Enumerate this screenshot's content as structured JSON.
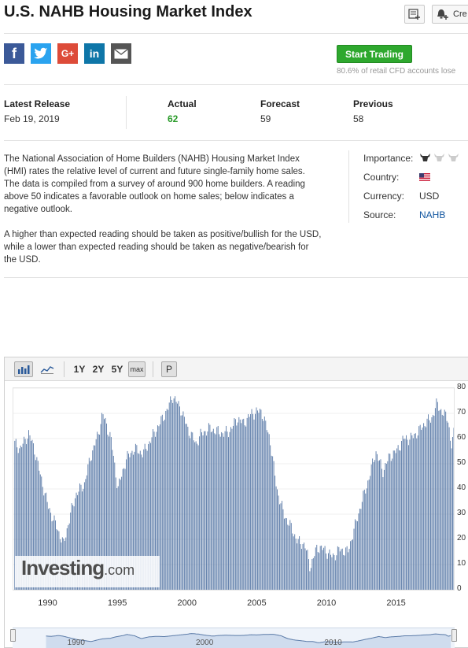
{
  "page": {
    "title": "U.S. NAHB Housing Market Index",
    "alert_label": "Cre"
  },
  "share": {
    "facebook": "f",
    "twitter": "t",
    "googleplus": "G+",
    "linkedin": "in",
    "email": "✉"
  },
  "cta": {
    "start_trading": "Start Trading",
    "risk_note": "80.6% of retail CFD accounts lose"
  },
  "release": {
    "latest_label": "Latest Release",
    "latest_date": "Feb 19, 2019",
    "actual_label": "Actual",
    "actual_value": "62",
    "forecast_label": "Forecast",
    "forecast_value": "59",
    "previous_label": "Previous",
    "previous_value": "58"
  },
  "description": {
    "p1": "The National Association of Home Builders (NAHB) Housing Market Index (HMI) rates the relative level of current and future single-family home sales. The data is compiled from a survey of around 900 home builders. A reading above 50 indicates a favorable outlook on home sales; below indicates a negative outlook.",
    "p2": "A higher than expected reading should be taken as positive/bullish for the USD, while a lower than expected reading should be taken as negative/bearish for the USD."
  },
  "info": {
    "importance_label": "Importance:",
    "importance_level": 1,
    "importance_max": 3,
    "country_label": "Country:",
    "country_flag": "us-flag-icon",
    "currency_label": "Currency:",
    "currency_value": "USD",
    "source_label": "Source:",
    "source_value": "NAHB"
  },
  "chart_toolbar": {
    "bar_icon": "bar-chart-icon",
    "line_icon": "line-chart-icon",
    "range_1y": "1Y",
    "range_2y": "2Y",
    "range_5y": "5Y",
    "range_max": "max",
    "print_label": "P"
  },
  "watermark": {
    "brand": "Investing",
    "suffix": ".com"
  },
  "colors": {
    "bar": "#5b7ba8",
    "bar_dark": "#3d5f8c",
    "accent_green": "#2ea82e",
    "link": "#1256a0"
  },
  "chart_data": {
    "type": "bar",
    "title": "",
    "xlabel": "",
    "ylabel": "",
    "ylim": [
      0,
      80
    ],
    "y_ticks": [
      0,
      10,
      20,
      30,
      40,
      50,
      60,
      70,
      80
    ],
    "x_ticks": [
      "1990",
      "1995",
      "2000",
      "2005",
      "2010",
      "2015"
    ],
    "x_range": [
      1987.5,
      2019.1
    ],
    "anchors": [
      [
        1987.6,
        58
      ],
      [
        1988.0,
        56
      ],
      [
        1988.6,
        62
      ],
      [
        1989.0,
        56
      ],
      [
        1989.5,
        44
      ],
      [
        1990.0,
        33
      ],
      [
        1990.6,
        25
      ],
      [
        1991.1,
        18
      ],
      [
        1991.6,
        30
      ],
      [
        1992.0,
        38
      ],
      [
        1992.6,
        42
      ],
      [
        1993.0,
        52
      ],
      [
        1993.6,
        62
      ],
      [
        1993.9,
        70
      ],
      [
        1994.5,
        60
      ],
      [
        1995.0,
        40
      ],
      [
        1995.6,
        52
      ],
      [
        1996.2,
        56
      ],
      [
        1996.8,
        54
      ],
      [
        1997.4,
        60
      ],
      [
        1998.0,
        66
      ],
      [
        1998.6,
        72
      ],
      [
        1998.9,
        77
      ],
      [
        1999.5,
        72
      ],
      [
        2000.0,
        64
      ],
      [
        2000.6,
        58
      ],
      [
        2001.0,
        62
      ],
      [
        2001.6,
        64
      ],
      [
        2002.0,
        63
      ],
      [
        2002.6,
        62
      ],
      [
        2003.0,
        63
      ],
      [
        2003.6,
        68
      ],
      [
        2004.0,
        66
      ],
      [
        2004.6,
        70
      ],
      [
        2005.3,
        71
      ],
      [
        2005.9,
        60
      ],
      [
        2006.4,
        40
      ],
      [
        2006.9,
        30
      ],
      [
        2007.4,
        25
      ],
      [
        2007.9,
        19
      ],
      [
        2008.4,
        18
      ],
      [
        2008.8,
        9
      ],
      [
        2009.3,
        17
      ],
      [
        2009.8,
        16
      ],
      [
        2010.4,
        13
      ],
      [
        2010.9,
        16
      ],
      [
        2011.5,
        15
      ],
      [
        2012.0,
        25
      ],
      [
        2012.5,
        35
      ],
      [
        2013.0,
        44
      ],
      [
        2013.5,
        55
      ],
      [
        2014.0,
        47
      ],
      [
        2014.5,
        53
      ],
      [
        2015.0,
        55
      ],
      [
        2015.5,
        60
      ],
      [
        2016.0,
        60
      ],
      [
        2016.6,
        63
      ],
      [
        2017.0,
        66
      ],
      [
        2017.5,
        68
      ],
      [
        2017.9,
        74
      ],
      [
        2018.3,
        70
      ],
      [
        2018.7,
        68
      ],
      [
        2018.9,
        56
      ],
      [
        2019.1,
        62
      ]
    ]
  },
  "navigator": {
    "ticks": [
      "1990",
      "2000",
      "2010"
    ]
  }
}
